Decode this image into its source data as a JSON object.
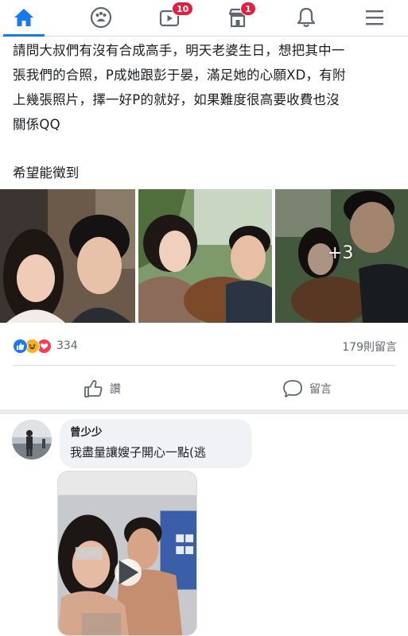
{
  "nav": {
    "items": [
      {
        "icon": "home-icon",
        "active": true
      },
      {
        "icon": "groups-icon"
      },
      {
        "icon": "watch-icon",
        "badge": "10"
      },
      {
        "icon": "marketplace-icon",
        "badge": "1"
      },
      {
        "icon": "notifications-icon"
      },
      {
        "icon": "menu-icon"
      }
    ],
    "accent": "#1877f2",
    "badge_color": "#e41e3f"
  },
  "post": {
    "line1": "請問大叔們有沒有合成高手，明天老婆生日，想把其中一",
    "line2": "張我們的合照，P成她跟彭于晏，滿足她的心願XD，有附",
    "line3": "上幾張照片，擇一好P的就好，如果難度很高要收費也沒",
    "line4": "關係QQ",
    "line5": "希望能徵到",
    "photos": [
      "selfie-photo",
      "capybara-selfie-photo",
      "capybara-selfie-photo"
    ],
    "more_photos": "+3"
  },
  "stats": {
    "reaction_icons": [
      "like-reaction-icon",
      "haha-reaction-icon",
      "love-reaction-icon"
    ],
    "reaction_count": "334",
    "comment_count": "179則留言"
  },
  "actions": {
    "like_label": "讚",
    "comment_label": "留言"
  },
  "comment": {
    "author": "曾少少",
    "text": "我盡量讓嫂子開心一點(逃",
    "media": "video-thumbnail"
  }
}
